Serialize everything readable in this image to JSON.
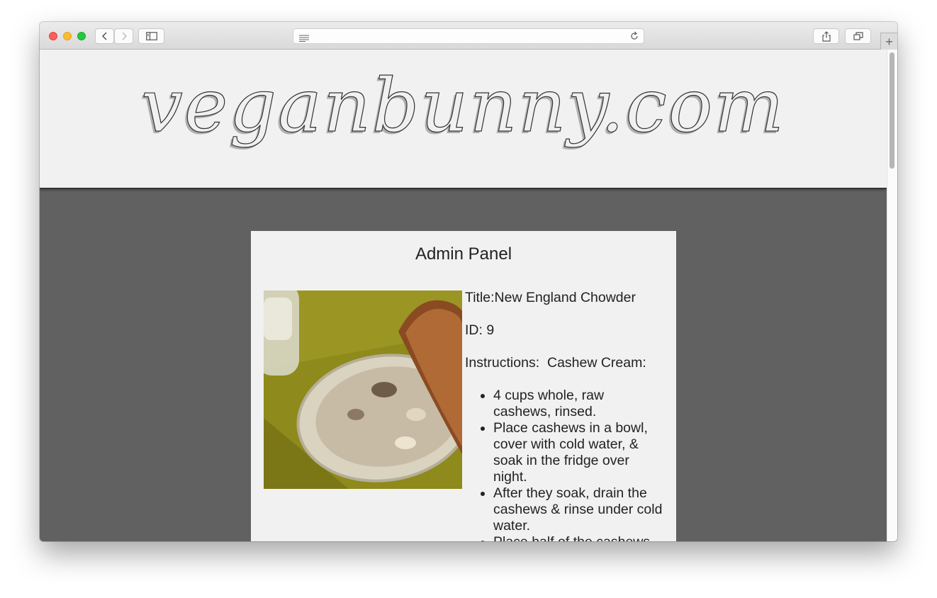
{
  "browser": {
    "url_text": ""
  },
  "site": {
    "logo": "veganbunny.com"
  },
  "panel": {
    "heading": "Admin Panel",
    "image_alt": "bowl of chowder with bread",
    "title_label": "Title:",
    "title_value": "New England Chowder",
    "id_label": "ID:",
    "id_value": "9",
    "instructions_label": "Instructions:",
    "instructions_intro": "Cashew Cream:",
    "steps": [
      "4 cups whole, raw cashews, rinsed.",
      "Place cashews in a bowl, cover with cold water, & soak in the fridge over night.",
      "After they soak, drain the cashews & rinse under cold water.",
      "Place half of the cashews"
    ]
  },
  "colors": {
    "page_background": "#616161",
    "header_background": "#f1f1f1",
    "panel_background": "#f1f1f1"
  }
}
